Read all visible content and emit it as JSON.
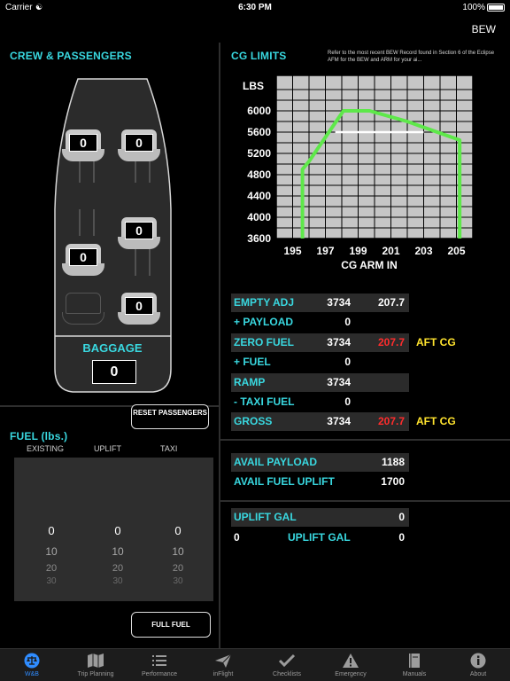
{
  "status": {
    "carrier": "Carrier",
    "time": "6:30 PM",
    "battery": "100%"
  },
  "header": {
    "bew_label": "BEW"
  },
  "crew": {
    "title": "CREW & PASSENGERS",
    "seats": [
      "0",
      "0",
      "0",
      "0",
      "0"
    ],
    "baggage_label": "BAGGAGE",
    "baggage_value": "0",
    "reset_button": "RESET PASSENGERS"
  },
  "fuel": {
    "title": "FUEL (lbs.)",
    "columns": [
      "EXISTING",
      "UPLIFT",
      "TAXI"
    ],
    "picker_values": [
      "0",
      "10",
      "20",
      "30"
    ],
    "full_fuel_button": "FULL FUEL"
  },
  "cg": {
    "title": "CG LIMITS",
    "note": "Refer to the most recent BEW Record found in Section 6 of the Eclipse AFM for the BEW and ARM for your ai..."
  },
  "chart_data": {
    "type": "line",
    "title": "",
    "xlabel": "CG ARM IN",
    "ylabel": "LBS",
    "xlim": [
      194,
      206
    ],
    "ylim": [
      3600,
      6400
    ],
    "xticks": [
      195,
      197,
      199,
      201,
      203,
      205
    ],
    "yticks": [
      3600,
      4000,
      4400,
      4800,
      5200,
      5600,
      6000
    ],
    "grid": true,
    "series": [
      {
        "color": "#5ee84a",
        "x": [
          195.6,
          195.6,
          196.0,
          198.1,
          199.7,
          202.0,
          205.2,
          205.2
        ],
        "y": [
          3600,
          4900,
          5050,
          6000,
          6000,
          5800,
          5450,
          3600
        ]
      },
      {
        "color": "#ffffff",
        "x": [
          197.6,
          203.0
        ],
        "y": [
          5600,
          5600
        ]
      }
    ]
  },
  "wb": {
    "empty_adj": {
      "label": "EMPTY ADJ",
      "weight": "3734",
      "arm": "207.7"
    },
    "payload": {
      "label": "+ PAYLOAD",
      "weight": "0"
    },
    "zero_fuel": {
      "label": "ZERO FUEL",
      "weight": "3734",
      "arm": "207.7",
      "flag": "AFT CG"
    },
    "fuel": {
      "label": "+  FUEL",
      "weight": "0"
    },
    "ramp": {
      "label": "RAMP",
      "weight": "3734"
    },
    "taxi_fuel": {
      "label": "-  TAXI FUEL",
      "weight": "0"
    },
    "gross": {
      "label": "GROSS",
      "weight": "3734",
      "arm": "207.7",
      "flag": "AFT CG"
    },
    "avail_payload": {
      "label": "AVAIL PAYLOAD",
      "value": "1188"
    },
    "avail_fuel_uplift": {
      "label": "AVAIL FUEL UPLIFT",
      "value": "1700"
    },
    "uplift_gal": {
      "label": "UPLIFT GAL",
      "value": "0"
    },
    "uplift_gal_2": {
      "left": "0",
      "label": "UPLIFT GAL",
      "value": "0"
    }
  },
  "tabs": [
    {
      "label": "W&B",
      "icon": "scale-icon"
    },
    {
      "label": "Trip Planning",
      "icon": "map-icon"
    },
    {
      "label": "Performance",
      "icon": "list-icon"
    },
    {
      "label": "inFlight",
      "icon": "plane-icon"
    },
    {
      "label": "Checklists",
      "icon": "check-icon"
    },
    {
      "label": "Emergency",
      "icon": "warning-icon"
    },
    {
      "label": "Manuals",
      "icon": "book-icon"
    },
    {
      "label": "About",
      "icon": "info-icon"
    }
  ],
  "colors": {
    "accent": "#39d8e0",
    "warning_red": "#ff2c2c",
    "warning_yellow": "#ffe32e",
    "envelope": "#5ee84a",
    "tab_active": "#2f8cff"
  }
}
